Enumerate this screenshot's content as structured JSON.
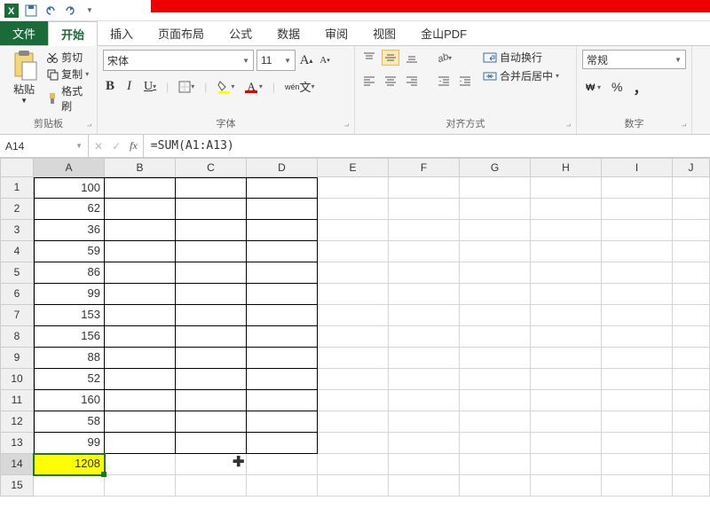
{
  "tabs": {
    "file": "文件",
    "home": "开始",
    "insert": "插入",
    "layout": "页面布局",
    "formulas": "公式",
    "data": "数据",
    "review": "审阅",
    "view": "视图",
    "pdf": "金山PDF"
  },
  "clipboard": {
    "paste": "粘贴",
    "cut": "剪切",
    "copy": "复制",
    "fmt": "格式刷",
    "label": "剪贴板"
  },
  "font": {
    "name": "宋体",
    "size": "11",
    "label": "字体",
    "wen": "wén"
  },
  "align": {
    "wrap": "自动换行",
    "merge": "合并后居中",
    "label": "对齐方式"
  },
  "number": {
    "fmt": "常规",
    "label": "数字",
    "pct": "%",
    "comma": "，"
  },
  "namebox": "A14",
  "formula": "=SUM(A1:A13)",
  "cols": [
    "A",
    "B",
    "C",
    "D",
    "E",
    "F",
    "G",
    "H",
    "I",
    "J"
  ],
  "rows": [
    {
      "n": 1,
      "a": "100"
    },
    {
      "n": 2,
      "a": "62"
    },
    {
      "n": 3,
      "a": "36"
    },
    {
      "n": 4,
      "a": "59"
    },
    {
      "n": 5,
      "a": "86"
    },
    {
      "n": 6,
      "a": "99"
    },
    {
      "n": 7,
      "a": "153"
    },
    {
      "n": 8,
      "a": "156"
    },
    {
      "n": 9,
      "a": "88"
    },
    {
      "n": 10,
      "a": "52"
    },
    {
      "n": 11,
      "a": "160"
    },
    {
      "n": 12,
      "a": "58"
    },
    {
      "n": 13,
      "a": "99"
    },
    {
      "n": 14,
      "a": "1208"
    },
    {
      "n": 15,
      "a": ""
    }
  ],
  "activeRow": 14,
  "borderedRows": 13,
  "yellowRow": 14
}
